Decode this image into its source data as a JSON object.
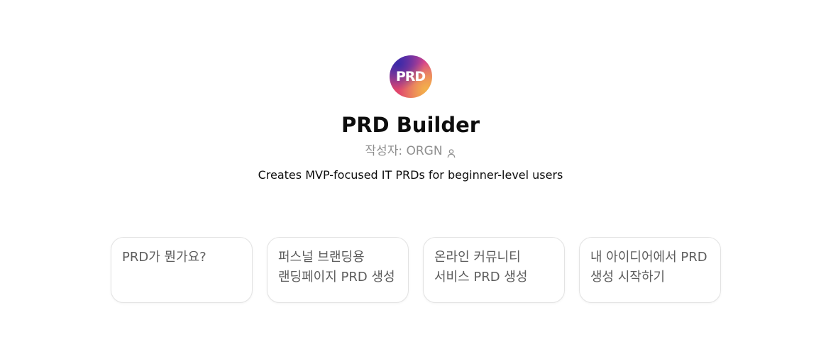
{
  "gpt": {
    "logo_text": "PRD",
    "name": "PRD Builder",
    "author_label": "작성자: ORGN",
    "author_icon": "person-icon",
    "description": "Creates MVP-focused IT PRDs for beginner-level users"
  },
  "starters": [
    {
      "label": "PRD가 뭔가요?"
    },
    {
      "label": "퍼스널 브랜딩용 랜딩페이지 PRD 생성"
    },
    {
      "label": "온라인 커뮤니티 서비스 PRD 생성"
    },
    {
      "label": "내 아이디어에서 PRD 생성 시작하기"
    }
  ]
}
